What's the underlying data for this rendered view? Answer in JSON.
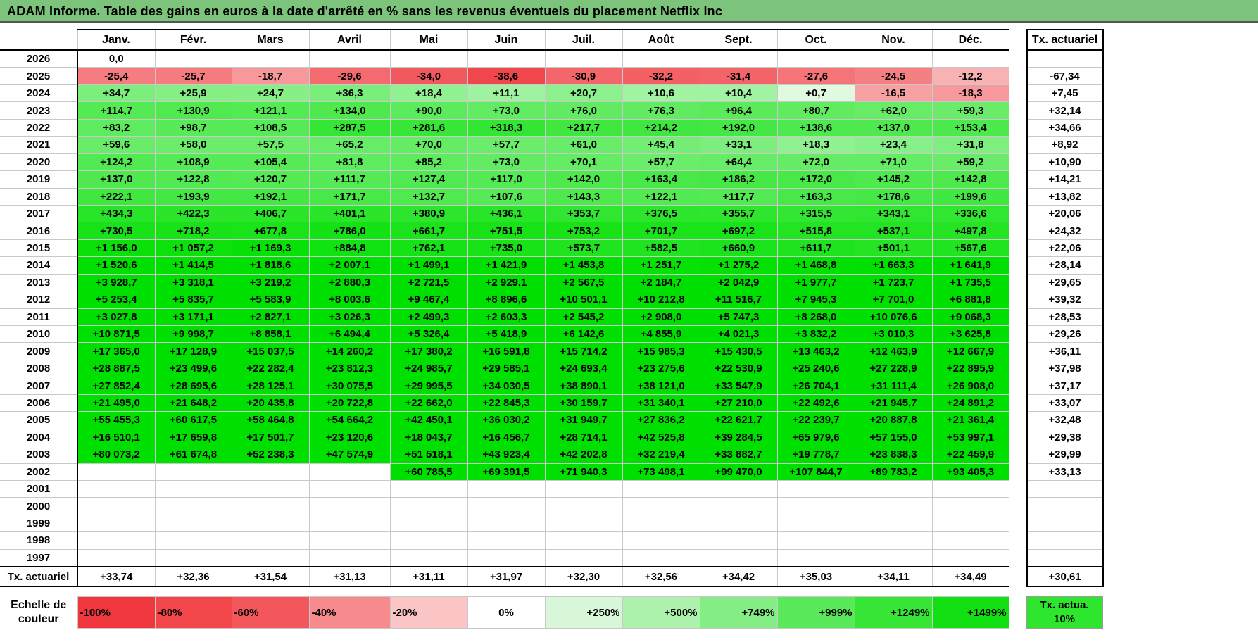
{
  "title": "ADAM Informe. Table des gains en euros à la date d'arrêté en % sans les revenus éventuels du placement Netflix Inc",
  "months": [
    "Janv.",
    "Févr.",
    "Mars",
    "Avril",
    "Mai",
    "Juin",
    "Juil.",
    "Août",
    "Sept.",
    "Oct.",
    "Nov.",
    "Déc."
  ],
  "tx_header": "Tx. actuariel",
  "rows": [
    {
      "year": "2026",
      "values": [
        "0,0",
        "",
        "",
        "",
        "",
        "",
        "",
        "",
        "",
        "",
        "",
        ""
      ],
      "tx": ""
    },
    {
      "year": "2025",
      "values": [
        "-25,4",
        "-25,7",
        "-18,7",
        "-29,6",
        "-34,0",
        "-38,6",
        "-30,9",
        "-32,2",
        "-31,4",
        "-27,6",
        "-24,5",
        "-12,2"
      ],
      "tx": "-67,34"
    },
    {
      "year": "2024",
      "values": [
        "+34,7",
        "+25,9",
        "+24,7",
        "+36,3",
        "+18,4",
        "+11,1",
        "+20,7",
        "+10,6",
        "+10,4",
        "+0,7",
        "-16,5",
        "-18,3"
      ],
      "tx": "+7,45"
    },
    {
      "year": "2023",
      "values": [
        "+114,7",
        "+130,9",
        "+121,1",
        "+134,0",
        "+90,0",
        "+73,0",
        "+76,0",
        "+76,3",
        "+96,4",
        "+80,7",
        "+62,0",
        "+59,3"
      ],
      "tx": "+32,14"
    },
    {
      "year": "2022",
      "values": [
        "+83,2",
        "+98,7",
        "+108,5",
        "+287,5",
        "+281,6",
        "+318,3",
        "+217,7",
        "+214,2",
        "+192,0",
        "+138,6",
        "+137,0",
        "+153,4"
      ],
      "tx": "+34,66"
    },
    {
      "year": "2021",
      "values": [
        "+59,6",
        "+58,0",
        "+57,5",
        "+65,2",
        "+70,0",
        "+57,7",
        "+61,0",
        "+45,4",
        "+33,1",
        "+18,3",
        "+23,4",
        "+31,8"
      ],
      "tx": "+8,92"
    },
    {
      "year": "2020",
      "values": [
        "+124,2",
        "+108,9",
        "+105,4",
        "+81,8",
        "+85,2",
        "+73,0",
        "+70,1",
        "+57,7",
        "+64,4",
        "+72,0",
        "+71,0",
        "+59,2"
      ],
      "tx": "+10,90"
    },
    {
      "year": "2019",
      "values": [
        "+137,0",
        "+122,8",
        "+120,7",
        "+111,7",
        "+127,4",
        "+117,0",
        "+142,0",
        "+163,4",
        "+186,2",
        "+172,0",
        "+145,2",
        "+142,8"
      ],
      "tx": "+14,21"
    },
    {
      "year": "2018",
      "values": [
        "+222,1",
        "+193,9",
        "+192,1",
        "+171,7",
        "+132,7",
        "+107,6",
        "+143,3",
        "+122,1",
        "+117,7",
        "+163,3",
        "+178,6",
        "+199,6"
      ],
      "tx": "+13,82"
    },
    {
      "year": "2017",
      "values": [
        "+434,3",
        "+422,3",
        "+406,7",
        "+401,1",
        "+380,9",
        "+436,1",
        "+353,7",
        "+376,5",
        "+355,7",
        "+315,5",
        "+343,1",
        "+336,6"
      ],
      "tx": "+20,06"
    },
    {
      "year": "2016",
      "values": [
        "+730,5",
        "+718,2",
        "+677,8",
        "+786,0",
        "+661,7",
        "+751,5",
        "+753,2",
        "+701,7",
        "+697,2",
        "+515,8",
        "+537,1",
        "+497,8"
      ],
      "tx": "+24,32"
    },
    {
      "year": "2015",
      "values": [
        "+1 156,0",
        "+1 057,2",
        "+1 169,3",
        "+884,8",
        "+762,1",
        "+735,0",
        "+573,7",
        "+582,5",
        "+660,9",
        "+611,7",
        "+501,1",
        "+567,6"
      ],
      "tx": "+22,06"
    },
    {
      "year": "2014",
      "values": [
        "+1 520,6",
        "+1 414,5",
        "+1 818,6",
        "+2 007,1",
        "+1 499,1",
        "+1 421,9",
        "+1 453,8",
        "+1 251,7",
        "+1 275,2",
        "+1 468,8",
        "+1 663,3",
        "+1 641,9"
      ],
      "tx": "+28,14"
    },
    {
      "year": "2013",
      "values": [
        "+3 928,7",
        "+3 318,1",
        "+3 219,2",
        "+2 880,3",
        "+2 721,5",
        "+2 929,1",
        "+2 567,5",
        "+2 184,7",
        "+2 042,9",
        "+1 977,7",
        "+1 723,7",
        "+1 735,5"
      ],
      "tx": "+29,65"
    },
    {
      "year": "2012",
      "values": [
        "+5 253,4",
        "+5 835,7",
        "+5 583,9",
        "+8 003,6",
        "+9 467,4",
        "+8 896,6",
        "+10 501,1",
        "+10 212,8",
        "+11 516,7",
        "+7 945,3",
        "+7 701,0",
        "+6 881,8"
      ],
      "tx": "+39,32"
    },
    {
      "year": "2011",
      "values": [
        "+3 027,8",
        "+3 171,1",
        "+2 827,1",
        "+3 026,3",
        "+2 499,3",
        "+2 603,3",
        "+2 545,2",
        "+2 908,0",
        "+5 747,3",
        "+8 268,0",
        "+10 076,6",
        "+9 068,3"
      ],
      "tx": "+28,53"
    },
    {
      "year": "2010",
      "values": [
        "+10 871,5",
        "+9 998,7",
        "+8 858,1",
        "+6 494,4",
        "+5 326,4",
        "+5 418,9",
        "+6 142,6",
        "+4 855,9",
        "+4 021,3",
        "+3 832,2",
        "+3 010,3",
        "+3 625,8"
      ],
      "tx": "+29,26"
    },
    {
      "year": "2009",
      "values": [
        "+17 365,0",
        "+17 128,9",
        "+15 037,5",
        "+14 260,2",
        "+17 380,2",
        "+16 591,8",
        "+15 714,2",
        "+15 985,3",
        "+15 430,5",
        "+13 463,2",
        "+12 463,9",
        "+12 667,9"
      ],
      "tx": "+36,11"
    },
    {
      "year": "2008",
      "values": [
        "+28 887,5",
        "+23 499,6",
        "+22 282,4",
        "+23 812,3",
        "+24 985,7",
        "+29 585,1",
        "+24 693,4",
        "+23 275,6",
        "+22 530,9",
        "+25 240,6",
        "+27 228,9",
        "+22 895,9"
      ],
      "tx": "+37,98"
    },
    {
      "year": "2007",
      "values": [
        "+27 852,4",
        "+28 695,6",
        "+28 125,1",
        "+30 075,5",
        "+29 995,5",
        "+34 030,5",
        "+38 890,1",
        "+38 121,0",
        "+33 547,9",
        "+26 704,1",
        "+31 111,4",
        "+26 908,0"
      ],
      "tx": "+37,17"
    },
    {
      "year": "2006",
      "values": [
        "+21 495,0",
        "+21 648,2",
        "+20 435,8",
        "+20 722,8",
        "+22 662,0",
        "+22 845,3",
        "+30 159,7",
        "+31 340,1",
        "+27 210,0",
        "+22 492,6",
        "+21 945,7",
        "+24 891,2"
      ],
      "tx": "+33,07"
    },
    {
      "year": "2005",
      "values": [
        "+55 455,3",
        "+60 617,5",
        "+58 464,8",
        "+54 664,2",
        "+42 450,1",
        "+36 030,2",
        "+31 949,7",
        "+27 836,2",
        "+22 621,7",
        "+22 239,7",
        "+20 887,8",
        "+21 361,4"
      ],
      "tx": "+32,48"
    },
    {
      "year": "2004",
      "values": [
        "+16 510,1",
        "+17 659,8",
        "+17 501,7",
        "+23 120,6",
        "+18 043,7",
        "+16 456,7",
        "+28 714,1",
        "+42 525,8",
        "+39 284,5",
        "+65 979,6",
        "+57 155,0",
        "+53 997,1"
      ],
      "tx": "+29,38"
    },
    {
      "year": "2003",
      "values": [
        "+80 073,2",
        "+61 674,8",
        "+52 238,3",
        "+47 574,9",
        "+51 518,1",
        "+43 923,4",
        "+42 202,8",
        "+32 219,4",
        "+33 882,7",
        "+19 778,7",
        "+23 838,3",
        "+22 459,9"
      ],
      "tx": "+29,99"
    },
    {
      "year": "2002",
      "values": [
        "",
        "",
        "",
        "",
        "+60 785,5",
        "+69 391,5",
        "+71 940,3",
        "+73 498,1",
        "+99 470,0",
        "+107 844,7",
        "+89 783,2",
        "+93 405,3"
      ],
      "tx": "+33,13"
    },
    {
      "year": "2001",
      "values": [
        "",
        "",
        "",
        "",
        "",
        "",
        "",
        "",
        "",
        "",
        "",
        ""
      ],
      "tx": ""
    },
    {
      "year": "2000",
      "values": [
        "",
        "",
        "",
        "",
        "",
        "",
        "",
        "",
        "",
        "",
        "",
        ""
      ],
      "tx": ""
    },
    {
      "year": "1999",
      "values": [
        "",
        "",
        "",
        "",
        "",
        "",
        "",
        "",
        "",
        "",
        "",
        ""
      ],
      "tx": ""
    },
    {
      "year": "1998",
      "values": [
        "",
        "",
        "",
        "",
        "",
        "",
        "",
        "",
        "",
        "",
        "",
        ""
      ],
      "tx": ""
    },
    {
      "year": "1997",
      "values": [
        "",
        "",
        "",
        "",
        "",
        "",
        "",
        "",
        "",
        "",
        "",
        ""
      ],
      "tx": ""
    }
  ],
  "footer": {
    "label": "Tx. actuariel",
    "values": [
      "+33,74",
      "+32,36",
      "+31,54",
      "+31,13",
      "+31,11",
      "+31,97",
      "+32,30",
      "+32,56",
      "+34,42",
      "+35,03",
      "+34,11",
      "+34,49"
    ],
    "tx": "+30,61"
  },
  "legend": {
    "label": "Echelle de couleur",
    "items": [
      {
        "text": "-100%",
        "color": "#f0373d",
        "kind": "neg"
      },
      {
        "text": "-80%",
        "color": "#f2464b",
        "kind": "neg"
      },
      {
        "text": "-60%",
        "color": "#f4575b",
        "kind": "neg"
      },
      {
        "text": "-40%",
        "color": "#f68a8d",
        "kind": "neg"
      },
      {
        "text": "-20%",
        "color": "#fbc4c5",
        "kind": "neg"
      },
      {
        "text": "0%",
        "color": "#ffffff",
        "kind": "zero"
      },
      {
        "text": "+250%",
        "color": "#d8f7d8",
        "kind": "pos"
      },
      {
        "text": "+500%",
        "color": "#acf2ac",
        "kind": "pos"
      },
      {
        "text": "+749%",
        "color": "#84ed84",
        "kind": "pos"
      },
      {
        "text": "+999%",
        "color": "#5ae95a",
        "kind": "pos"
      },
      {
        "text": "+1249%",
        "color": "#37e537",
        "kind": "pos"
      },
      {
        "text": "+1499%",
        "color": "#13e013",
        "kind": "pos"
      }
    ],
    "tx_label": "Tx. actua. 10%",
    "tx_color": "#2ee62e"
  },
  "colors": {
    "title_bar": "#7cc47c",
    "neg_scale": [
      "#fde4e4",
      "#f04146"
    ],
    "pos_scale": [
      "#f1fcf1",
      "#00e000"
    ]
  }
}
